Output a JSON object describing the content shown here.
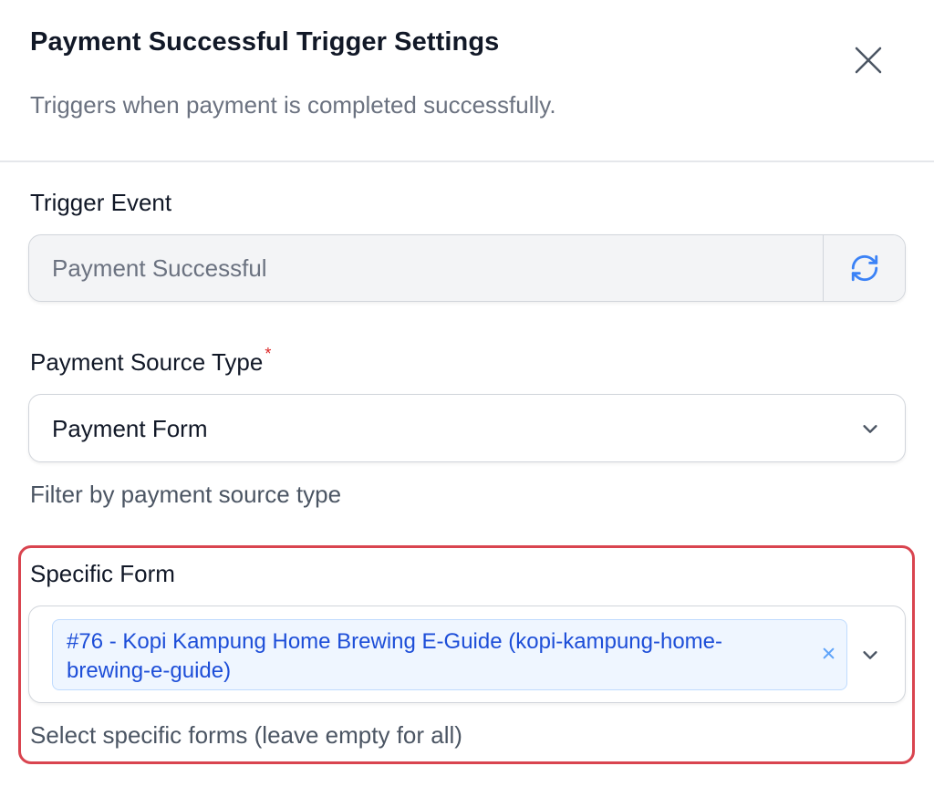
{
  "header": {
    "title": "Payment Successful Trigger Settings",
    "subtitle": "Triggers when payment is completed successfully.",
    "close_icon": "close-icon"
  },
  "trigger_event": {
    "label": "Trigger Event",
    "value": "Payment Successful",
    "refresh_icon": "refresh-icon"
  },
  "payment_source": {
    "label": "Payment Source Type",
    "required_marker": "*",
    "value": "Payment Form",
    "helper": "Filter by payment source type",
    "chevron_icon": "chevron-down-icon"
  },
  "specific_form": {
    "label": "Specific Form",
    "selected": [
      {
        "label": "#76 - Kopi Kampung Home Brewing E-Guide (kopi-kampung-home-brewing-e-guide)",
        "remove_icon": "remove-icon"
      }
    ],
    "helper": "Select specific forms (leave empty for all)",
    "chevron_icon": "chevron-down-icon"
  },
  "colors": {
    "highlight_border": "#d9444f",
    "chip_background": "#eff6ff",
    "chip_text": "#1d4ed8",
    "refresh_icon": "#3b82f6",
    "required": "#dc2626"
  }
}
